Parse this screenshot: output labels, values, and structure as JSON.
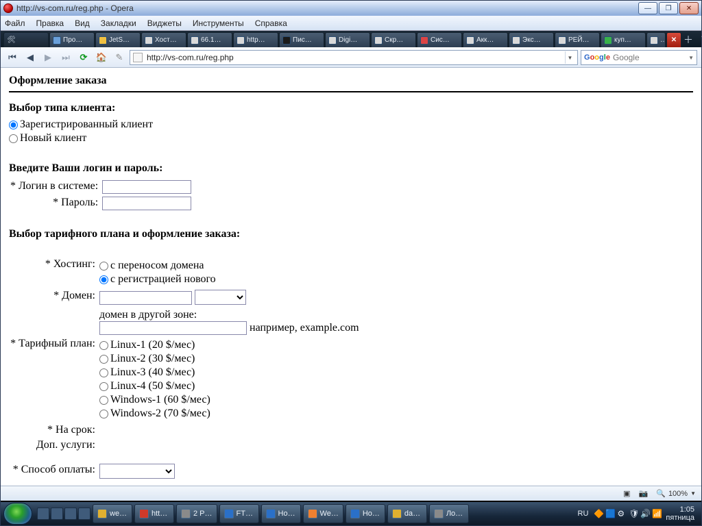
{
  "window": {
    "title": "http://vs-com.ru/reg.php - Opera"
  },
  "menubar": [
    "Файл",
    "Правка",
    "Вид",
    "Закладки",
    "Виджеты",
    "Инструменты",
    "Справка"
  ],
  "tabs": [
    "Про…",
    "JetS…",
    "Хост…",
    "66.1…",
    "http…",
    "Пис…",
    "Digi…",
    "Скр…",
    "Сис…",
    "Акк…",
    "Экс…",
    "РЕЙ…",
    "куп…",
    "…"
  ],
  "address": {
    "url": "http://vs-com.ru/reg.php"
  },
  "search": {
    "engine": "Google"
  },
  "page": {
    "heading": "Оформление заказа",
    "client_type": {
      "title": "Выбор типа клиента:",
      "opt_registered": "Зарегистрированный клиент",
      "opt_new": "Новый клиент"
    },
    "login_section": {
      "title": "Введите Ваши логин и пароль:",
      "login_label": "* Логин в системе:",
      "password_label": "* Пароль:"
    },
    "plan_section": {
      "title": "Выбор тарифного плана и оформление заказа:",
      "hosting_label": "* Хостинг:",
      "hosting_opt1": "с переносом домена",
      "hosting_opt2": "с регистрацией нового",
      "domain_label": "* Домен:",
      "domain_alt": "домен в другой зоне:",
      "domain_hint": "например, example.com",
      "plan_label": "* Тарифный план:",
      "plans": [
        "Linux-1 (20 $/мес)",
        "Linux-2 (30 $/мес)",
        "Linux-3 (40 $/мес)",
        "Linux-4 (50 $/мес)",
        "Windows-1 (60 $/мес)",
        "Windows-2 (70 $/мес)"
      ],
      "term_label": "* На срок:",
      "extras_label": "Доп. услуги:",
      "payment_label": "* Способ оплаты:"
    }
  },
  "statusbar": {
    "zoom": "100%"
  },
  "taskbar": {
    "buttons": [
      "we…",
      "htt…",
      "2 P…",
      "FT…",
      "Ho…",
      "We…",
      "Ho…",
      "da…",
      "Ло…"
    ],
    "lang": "RU",
    "time": "1:05",
    "day": "пятница"
  }
}
